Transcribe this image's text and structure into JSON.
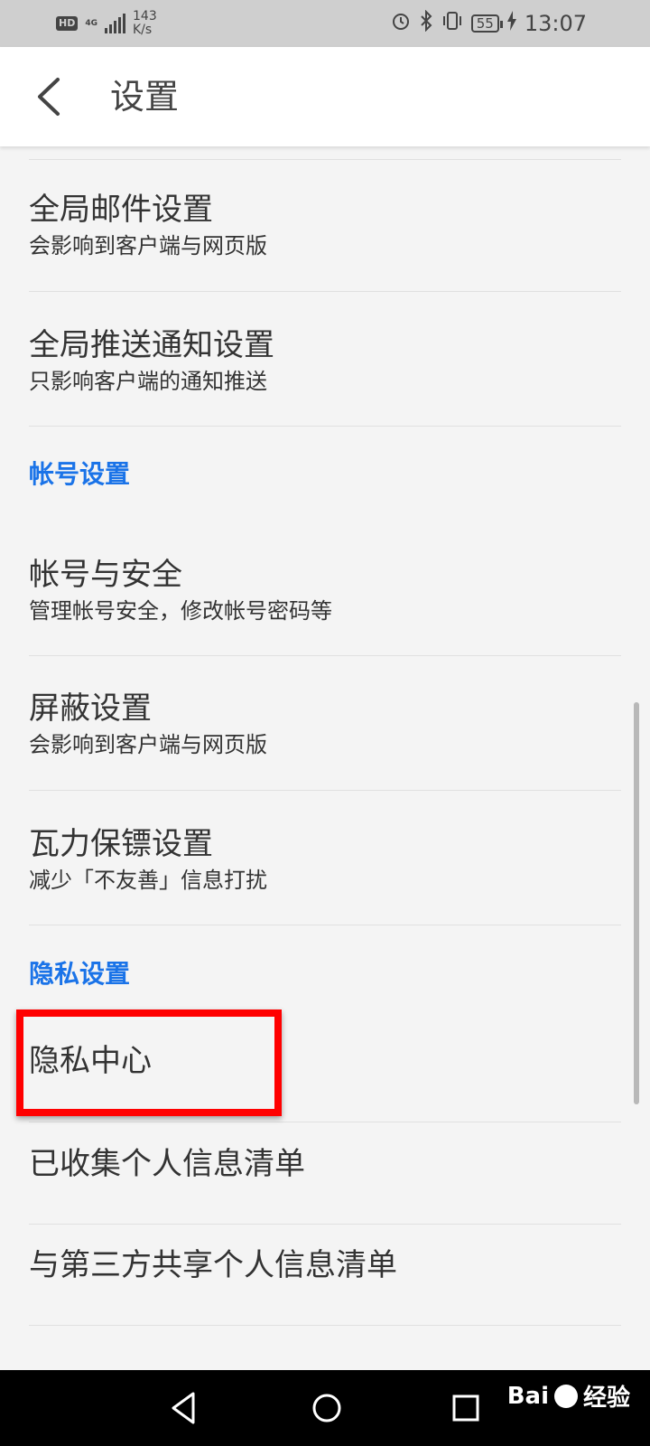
{
  "status_bar": {
    "network_badge": "HD",
    "network_type": "4G",
    "speed_value": "143",
    "speed_unit": "K/s",
    "battery": "55",
    "time": "13:07"
  },
  "header": {
    "title": "设置"
  },
  "items": [
    {
      "title": "全局邮件设置",
      "subtitle": "会影响到客户端与网页版"
    },
    {
      "title": "全局推送通知设置",
      "subtitle": "只影响客户端的通知推送"
    }
  ],
  "section_account": {
    "label": "帐号设置",
    "items": [
      {
        "title": "帐号与安全",
        "subtitle": "管理帐号安全，修改帐号密码等"
      },
      {
        "title": "屏蔽设置",
        "subtitle": "会影响到客户端与网页版"
      },
      {
        "title": "瓦力保镖设置",
        "subtitle": "减少「不友善」信息打扰"
      }
    ]
  },
  "section_privacy": {
    "label": "隐私设置",
    "items": [
      {
        "title": "隐私中心"
      },
      {
        "title": "已收集个人信息清单"
      },
      {
        "title": "与第三方共享个人信息清单"
      }
    ]
  },
  "watermark": {
    "brand": "Bai",
    "brand_suffix": "经验"
  },
  "colors": {
    "accent": "#1a73e8",
    "highlight": "#ff0000",
    "header_bg": "#ffffff",
    "page_bg": "#f4f4f4"
  }
}
